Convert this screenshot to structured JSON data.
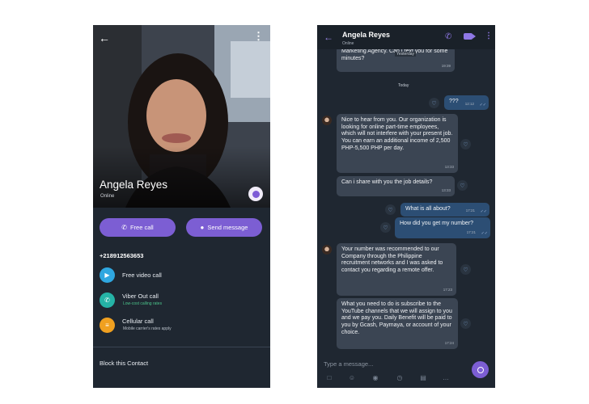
{
  "profile": {
    "name": "Angela Reyes",
    "status": "Online",
    "free_call_label": "Free call",
    "send_message_label": "Send message",
    "phone_number": "+218912563653",
    "options": [
      {
        "label": "Free video call",
        "sub": "",
        "icon": "video-icon"
      },
      {
        "label": "Viber Out call",
        "sub": "Low-cost calling rates",
        "icon": "phone-out-icon"
      },
      {
        "label": "Cellular call",
        "sub": "Mobile carrier's rates apply",
        "icon": "cellular-icon"
      }
    ],
    "block_label": "Block this Contact"
  },
  "chat": {
    "name": "Angela Reyes",
    "status": "Online",
    "prev_message": "Marketing Agency. Can I text you for some minutes?",
    "prev_time": "19:39",
    "date_yesterday": "Yesterday",
    "date_today": "Today",
    "messages": [
      {
        "dir": "out",
        "text": "???",
        "time": "12:12"
      },
      {
        "dir": "in",
        "text": "Nice to hear from you. Our organization is looking for online part-time employees, which will not interfere with your present job. You can earn an additional income of 2,500 PHP-5,500 PHP per day.",
        "time": "13:33"
      },
      {
        "dir": "in",
        "text": "Can i share with you the job details?",
        "time": "13:33"
      },
      {
        "dir": "out",
        "text": "What is all about?",
        "time": "17:21"
      },
      {
        "dir": "out",
        "text": "How did you get my number?",
        "time": "17:21"
      },
      {
        "dir": "in",
        "text": "Your number was recommended to our Company through the Philippine recruitment networks and I was asked to contact you regarding a remote offer.",
        "time": "17:23"
      },
      {
        "dir": "in",
        "text": "What you need to do is subscribe to the YouTube channels that we will assign to you and we pay you. Daily Benefit will be paid to you by Gcash, Paymaya, or account of your choice.",
        "time": "17:24"
      }
    ],
    "input_placeholder": "Type a message..."
  },
  "colors": {
    "accent": "#7c5ed3",
    "background": "#1f2731",
    "incoming_bubble": "#3b4553",
    "outgoing_bubble": "#2c4e74"
  }
}
